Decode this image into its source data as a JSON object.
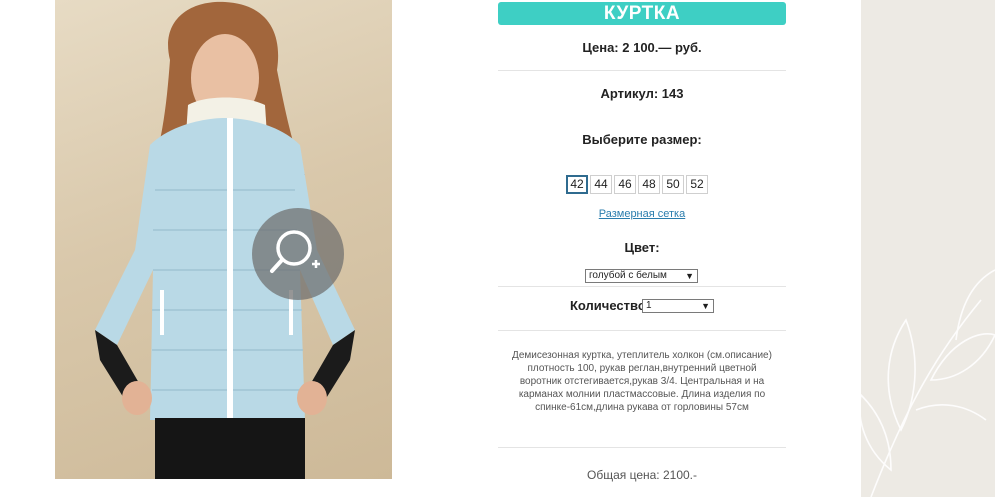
{
  "product": {
    "title": "КУРТКА",
    "price": "Цена: 2 100.— руб.",
    "article": "Артикул: 143",
    "size_prompt": "Выберите размер:",
    "sizes": [
      "42",
      "44",
      "46",
      "48",
      "50",
      "52"
    ],
    "selected_size": "42",
    "size_chart_link": "Размерная сетка",
    "color_label": "Цвет:",
    "color_value": "голубой с белым",
    "quantity_label": "Количество:",
    "quantity_value": "1",
    "description": "Демисезонная куртка, утеплитель холкон (см.описание) плотность 100, рукав реглан,внутренний цветной воротник отстегивается,рукав 3/4. Центральная и на карманах молнии пластмассовые. Длина изделия по спинке-61см,длина рукава от горловины 57см",
    "total": "Общая цена: 2100.-"
  },
  "photo": {
    "alt": "Woman in light blue quilted jacket",
    "zoom_icon": "zoom-in-icon"
  },
  "colors": {
    "accent": "#3ecfc4",
    "link": "#2b7dad",
    "jacket": "#b9d9e6",
    "side_background": "#edeae4"
  }
}
